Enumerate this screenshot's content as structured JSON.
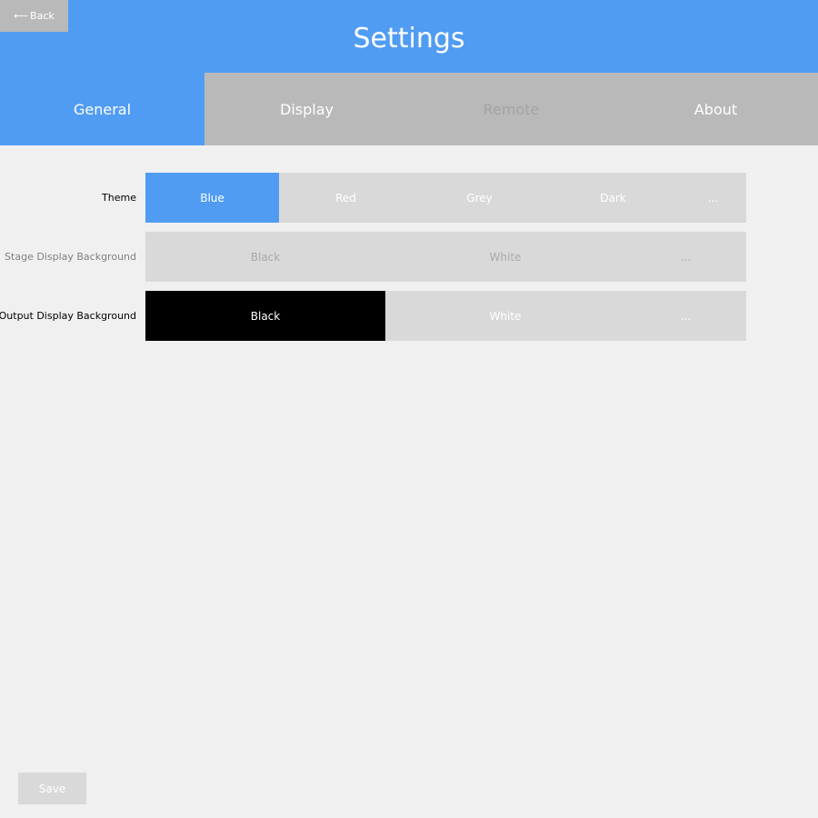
{
  "header": {
    "title": "Settings",
    "back_label": "Back"
  },
  "tabs": [
    {
      "label": "General",
      "state": "active"
    },
    {
      "label": "Display",
      "state": "normal"
    },
    {
      "label": "Remote",
      "state": "disabled"
    },
    {
      "label": "About",
      "state": "normal"
    }
  ],
  "settings": {
    "theme": {
      "label": "Theme",
      "options": [
        "Blue",
        "Red",
        "Grey",
        "Dark",
        "..."
      ],
      "selected": "Blue"
    },
    "stage_display_background": {
      "label": "Stage Display Background",
      "options": [
        "Black",
        "White",
        "..."
      ],
      "selected": null
    },
    "output_display_background": {
      "label": "Output Display Background",
      "options": [
        "Black",
        "White",
        "..."
      ],
      "selected": "Black"
    }
  },
  "footer": {
    "save_label": "Save"
  },
  "colors": {
    "accent": "#519cf3",
    "inactive": "#b9b9b9",
    "option_bg": "#d9d9d9",
    "page_bg": "#f0f0f0"
  }
}
